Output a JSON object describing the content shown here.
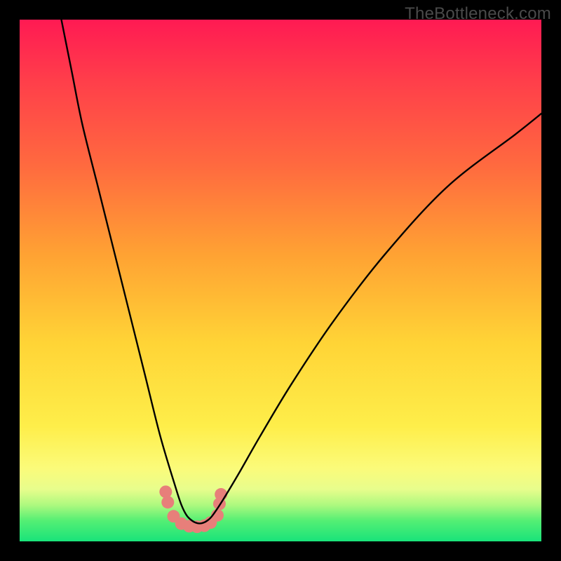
{
  "watermark": "TheBottleneck.com",
  "chart_data": {
    "type": "line",
    "title": "",
    "xlabel": "",
    "ylabel": "",
    "xlim": [
      0,
      100
    ],
    "ylim": [
      0,
      100
    ],
    "series": [
      {
        "name": "bottleneck-curve",
        "x": [
          8,
          10,
          12,
          15,
          18,
          21,
          24,
          27,
          30,
          31,
          32,
          33,
          34,
          35,
          36,
          37,
          39,
          42,
          46,
          52,
          60,
          70,
          82,
          95,
          100
        ],
        "values": [
          100,
          90,
          80,
          68,
          56,
          44,
          32,
          20,
          10,
          7,
          5,
          4,
          3.5,
          3.5,
          4,
          5,
          8,
          13,
          20,
          30,
          42,
          55,
          68,
          78,
          82
        ]
      }
    ],
    "markers": {
      "comment": "approximate positions of the salmon/pink dots near the trough, in (x%, y%) of plot area",
      "points": [
        [
          28.0,
          9.5
        ],
        [
          28.4,
          7.5
        ],
        [
          29.5,
          4.8
        ],
        [
          31.0,
          3.4
        ],
        [
          32.5,
          2.9
        ],
        [
          34.0,
          2.8
        ],
        [
          35.4,
          3.0
        ],
        [
          36.6,
          3.6
        ],
        [
          37.9,
          5.0
        ],
        [
          38.3,
          7.2
        ],
        [
          38.6,
          9.0
        ]
      ],
      "color": "#e77f7a",
      "radius_px": 9
    },
    "colors": {
      "curve": "#000000",
      "gradient_top": "#ff1a53",
      "gradient_mid": "#ffd436",
      "gradient_bottom": "#19e37a"
    }
  }
}
